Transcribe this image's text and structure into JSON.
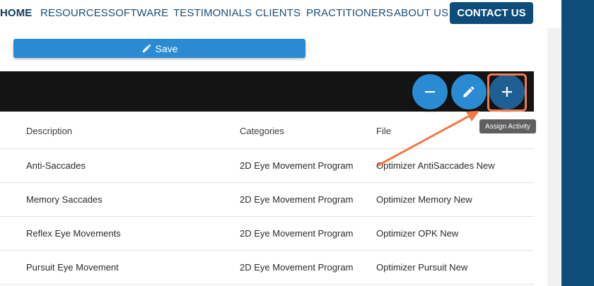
{
  "nav": {
    "items": [
      "HOME",
      "RESOURCES",
      "SOFTWARE",
      "TESTIMONIALS",
      "CLIENTS",
      "PRACTITIONERS",
      "ABOUT US"
    ],
    "contact": "CONTACT US"
  },
  "save_label": "Save",
  "tooltip": "Assign Activity",
  "table": {
    "headers": [
      "Description",
      "Categories",
      "File"
    ],
    "rows": [
      [
        "Anti-Saccades",
        "2D Eye Movement Program",
        "Optimizer AntiSaccades New"
      ],
      [
        "Memory Saccades",
        "2D Eye Movement Program",
        "Optimizer Memory New"
      ],
      [
        "Reflex Eye Movements",
        "2D Eye Movement Program",
        "Optimizer OPK New"
      ],
      [
        "Pursuit Eye Movement",
        "2D Eye Movement Program",
        "Optimizer Pursuit New"
      ]
    ]
  },
  "colors": {
    "brand": "#0e4d7a",
    "button": "#2a8bd2",
    "highlight": "#f27a46",
    "toolbar": "#141414"
  },
  "icons": {
    "remove": "minus-icon",
    "edit": "pencil-icon",
    "add": "plus-icon",
    "save": "pencil-icon"
  }
}
